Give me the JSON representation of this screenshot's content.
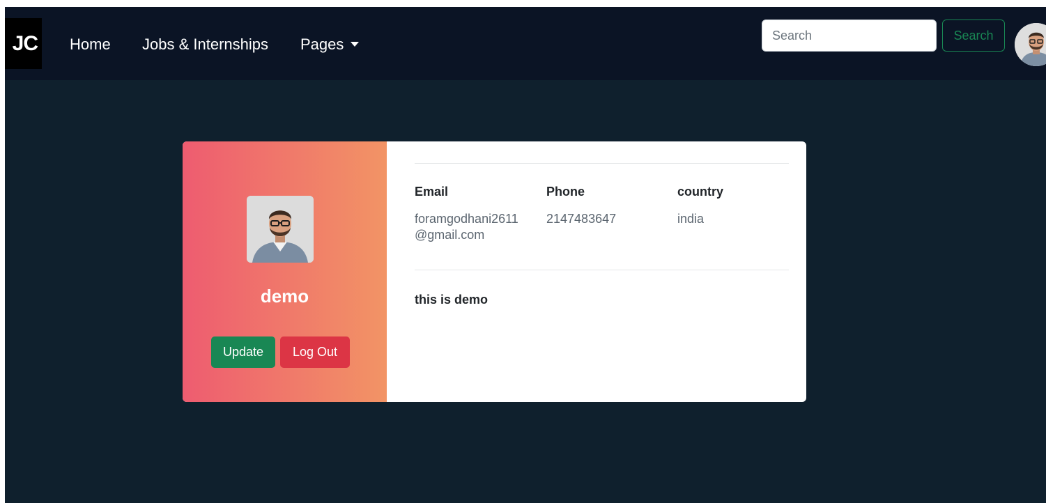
{
  "navbar": {
    "brand": "JC",
    "links": [
      {
        "label": "Home"
      },
      {
        "label": "Jobs & Internships"
      },
      {
        "label": "Pages",
        "dropdown": true
      }
    ],
    "search": {
      "placeholder": "Search",
      "button_label": "Search"
    },
    "avatar_icon": "user-avatar-icon"
  },
  "profile": {
    "name": "demo",
    "update_label": "Update",
    "logout_label": "Log Out",
    "fields": [
      {
        "label": "Email",
        "value": "foramgodhani2611@gmail.com"
      },
      {
        "label": "Phone",
        "value": "2147483647"
      },
      {
        "label": "country",
        "value": "india"
      }
    ],
    "bio": "this is demo"
  },
  "colors": {
    "navbar_bg": "#0b1425",
    "page_bg": "#0f202d",
    "gradient_start": "#ee5c70",
    "gradient_end": "#f29465",
    "success": "#198754",
    "danger": "#dc3545"
  }
}
